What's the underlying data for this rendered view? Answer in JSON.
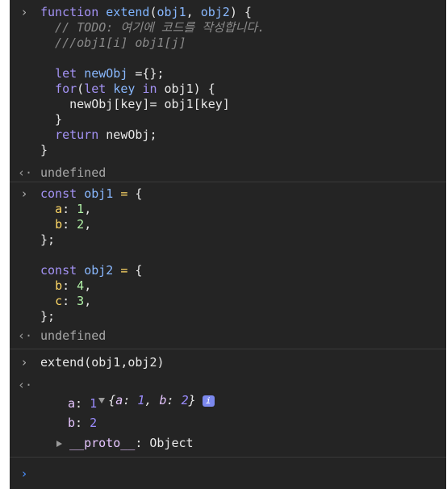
{
  "entries": [
    {
      "lines": [
        "function extend(obj1, obj2) {",
        "  // TODO: 여기에 코드를 작성합니다.",
        "  ///obj1[i] obj1[j]",
        "",
        "  let newObj ={};",
        "  for(let key in obj1) {",
        "    newObj[key]= obj1[key]",
        "  }",
        "  return newObj;",
        "}"
      ],
      "result": "undefined"
    },
    {
      "lines": [
        "const obj1 = {",
        "  a: 1,",
        "  b: 2,",
        "};",
        "",
        "const obj2 = {",
        "  b: 4,",
        "  c: 3,",
        "};"
      ],
      "result": "undefined"
    },
    {
      "lines": [
        "extend(obj1,obj2)"
      ],
      "result_preview": "{a: 1, b: 2}",
      "result_props": [
        {
          "key": "a",
          "value": "1"
        },
        {
          "key": "b",
          "value": "2"
        }
      ],
      "proto_label": "__proto__",
      "proto_value": "Object",
      "info_badge": "i"
    }
  ],
  "prompt_symbol": ">",
  "colors": {
    "background": "#242424",
    "keyword": "#c792ea",
    "function_name": "#7fb4ff",
    "property": "#ffd866",
    "number": "#b1f2a7",
    "comment": "#8a8a8a",
    "prompt": "#4a90ff"
  }
}
